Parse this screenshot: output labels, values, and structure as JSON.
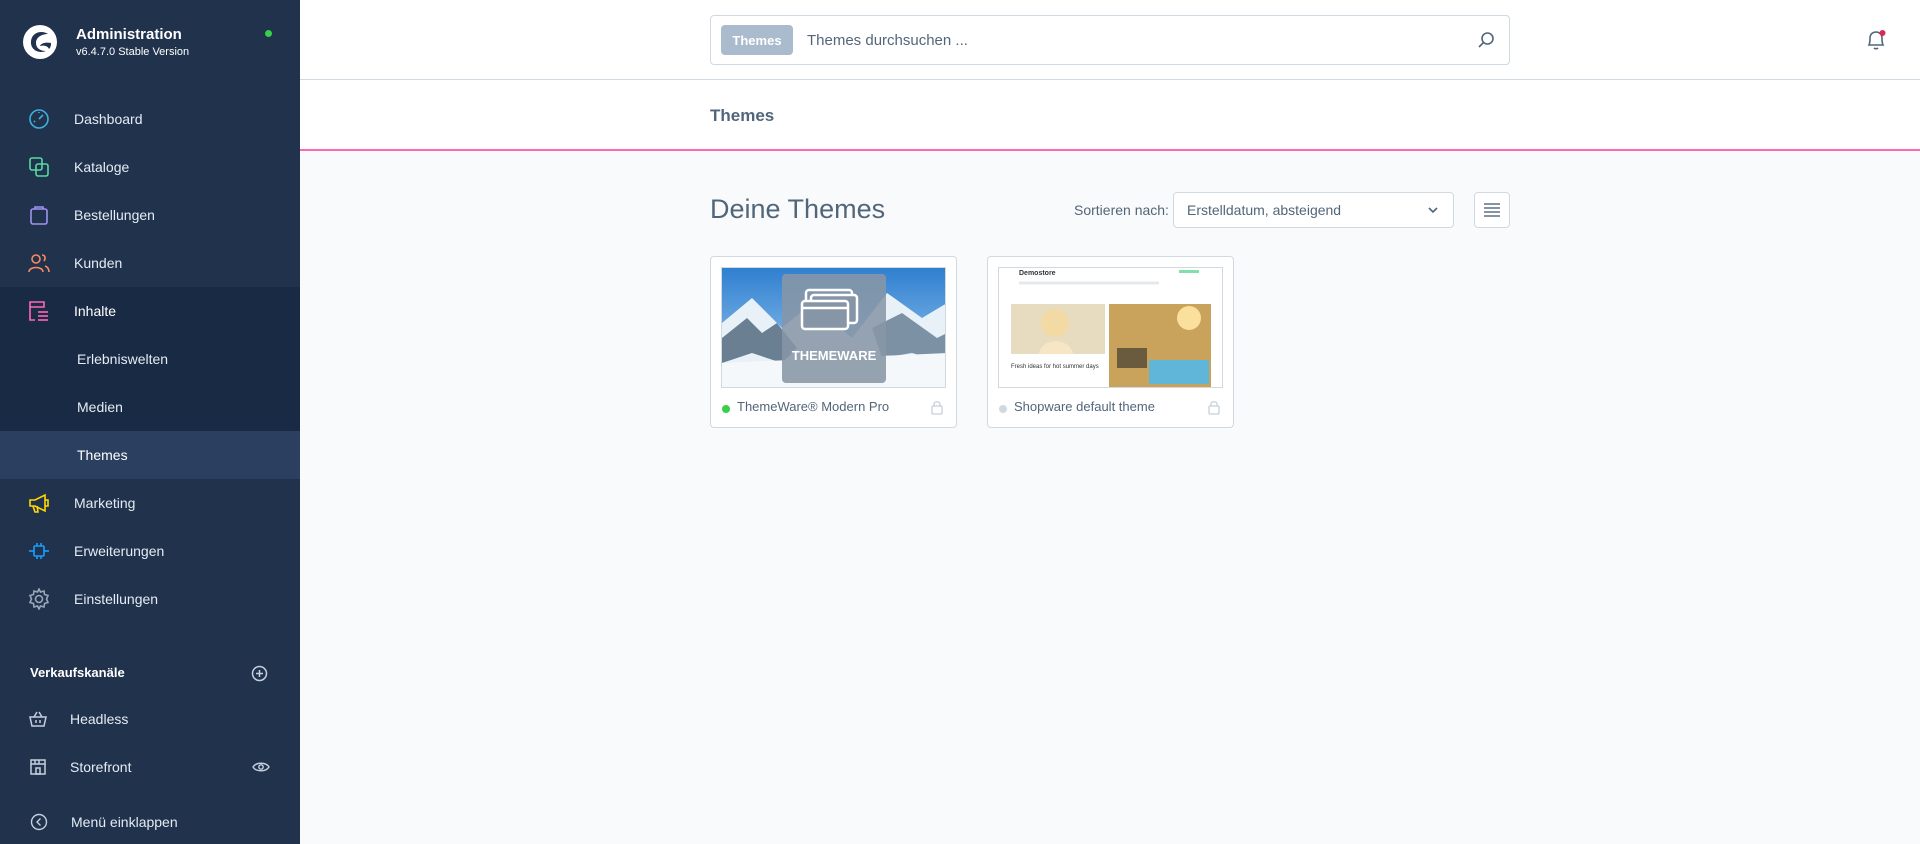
{
  "app": {
    "title": "Administration",
    "version": "v6.4.7.0 Stable Version"
  },
  "sidebar": {
    "items": [
      {
        "label": "Dashboard",
        "icon": "dashboard-icon"
      },
      {
        "label": "Kataloge",
        "icon": "catalog-icon"
      },
      {
        "label": "Bestellungen",
        "icon": "orders-icon"
      },
      {
        "label": "Kunden",
        "icon": "customers-icon"
      },
      {
        "label": "Inhalte",
        "icon": "content-icon"
      },
      {
        "label": "Marketing",
        "icon": "marketing-icon"
      },
      {
        "label": "Erweiterungen",
        "icon": "extensions-icon"
      },
      {
        "label": "Einstellungen",
        "icon": "settings-icon"
      }
    ],
    "subitems": [
      {
        "label": "Erlebniswelten"
      },
      {
        "label": "Medien"
      },
      {
        "label": "Themes"
      }
    ],
    "sales_channels_title": "Verkaufskanäle",
    "sales_channels": [
      {
        "label": "Headless",
        "icon": "basket-icon"
      },
      {
        "label": "Storefront",
        "icon": "storefront-icon"
      }
    ],
    "collapse_label": "Menü einklappen"
  },
  "search": {
    "tag": "Themes",
    "placeholder": "Themes durchsuchen ..."
  },
  "smartbar": {
    "title": "Themes"
  },
  "content": {
    "heading": "Deine Themes",
    "sort_label": "Sortieren nach:",
    "sort_value": "Erstelldatum, absteigend"
  },
  "themes": [
    {
      "name": "ThemeWare® Modern Pro",
      "active": true,
      "thumb_text": "THEMEWARE"
    },
    {
      "name": "Shopware default theme",
      "active": false,
      "thumb_brand": "Demostore",
      "thumb_headline": "Fresh ideas for hot summer days"
    }
  ],
  "colors": {
    "sidebar_bg": "#21324d",
    "accent_pink": "#ff68b4",
    "active_green": "#37d046",
    "inactive_gray": "#d1d9e0"
  }
}
